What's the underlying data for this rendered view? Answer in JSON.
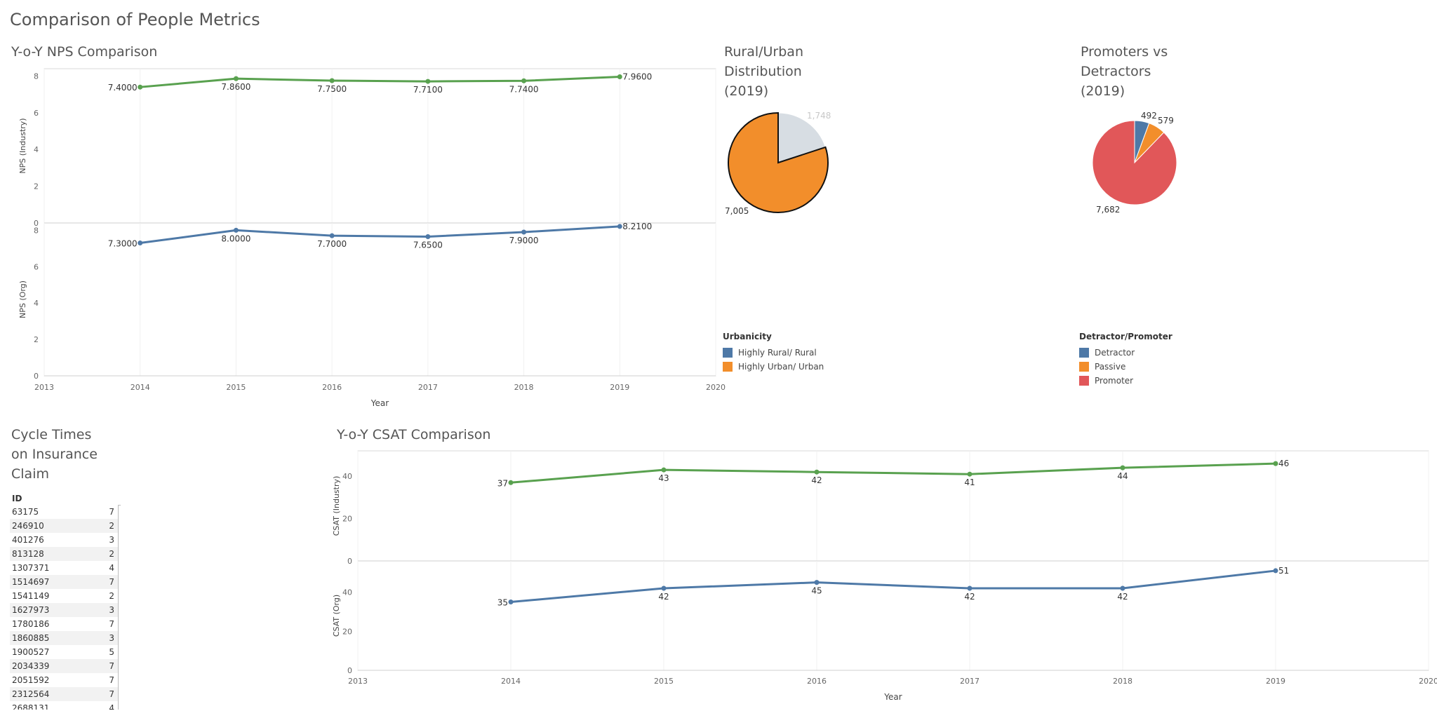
{
  "dashboard": {
    "title": "Comparison of People Metrics"
  },
  "nps": {
    "title": "Y-o-Y NPS Comparison",
    "xlabel": "Year"
  },
  "csat": {
    "title": "Y-o-Y CSAT Comparison",
    "xlabel": "Year"
  },
  "rural": {
    "title_lines": [
      "Rural/Urban",
      "Distribution",
      "(2019)"
    ],
    "legend_title": "Urbanicity",
    "legend": [
      "Highly Rural/ Rural",
      "Highly Urban/ Urban"
    ]
  },
  "promoters": {
    "title_lines": [
      "Promoters vs",
      "Detractors",
      "(2019)"
    ],
    "legend_title": "Detractor/Promoter",
    "legend": [
      "Detractor",
      "Passive",
      "Promoter"
    ]
  },
  "cycle": {
    "title_lines": [
      "Cycle Times",
      "on Insurance",
      "Claim"
    ],
    "column_header": "ID",
    "rows": [
      [
        "63175",
        "7"
      ],
      [
        "246910",
        "2"
      ],
      [
        "401276",
        "3"
      ],
      [
        "813128",
        "2"
      ],
      [
        "1307371",
        "4"
      ],
      [
        "1514697",
        "7"
      ],
      [
        "1541149",
        "2"
      ],
      [
        "1627973",
        "3"
      ],
      [
        "1780186",
        "7"
      ],
      [
        "1860885",
        "3"
      ],
      [
        "1900527",
        "5"
      ],
      [
        "2034339",
        "7"
      ],
      [
        "2051592",
        "7"
      ],
      [
        "2312564",
        "7"
      ],
      [
        "2688131",
        "4"
      ]
    ]
  },
  "colors": {
    "green": "#59a14f",
    "blue": "#4e79a7",
    "orange": "#f28e2b",
    "red": "#e15759",
    "light_gray": "#d7dde3"
  },
  "chart_data": [
    {
      "type": "line",
      "title": "Y-o-Y NPS Comparison",
      "xlabel": "Year",
      "x": [
        2014,
        2015,
        2016,
        2017,
        2018,
        2019
      ],
      "xlim": [
        2013,
        2020
      ],
      "x_ticks": [
        "2013",
        "2014",
        "2015",
        "2016",
        "2017",
        "2018",
        "2019",
        "2020"
      ],
      "series": [
        {
          "name": "NPS (Industry)",
          "values": [
            7.4,
            7.86,
            7.75,
            7.71,
            7.74,
            7.96
          ],
          "labels": [
            "7.4000",
            "7.8600",
            "7.7500",
            "7.7100",
            "7.7400",
            "7.9600"
          ],
          "ylim": [
            0,
            8.4
          ],
          "y_ticks": [
            "0",
            "2",
            "4",
            "6",
            "8"
          ]
        },
        {
          "name": "NPS (Org)",
          "values": [
            7.3,
            8.0,
            7.7,
            7.65,
            7.9,
            8.21
          ],
          "labels": [
            "7.3000",
            "8.0000",
            "7.7000",
            "7.6500",
            "7.9000",
            "8.2100"
          ],
          "ylim": [
            0,
            8.4
          ],
          "y_ticks": [
            "0",
            "2",
            "4",
            "6",
            "8"
          ]
        }
      ],
      "grid": true
    },
    {
      "type": "line",
      "title": "Y-o-Y CSAT Comparison",
      "xlabel": "Year",
      "x": [
        2014,
        2015,
        2016,
        2017,
        2018,
        2019
      ],
      "xlim": [
        2013,
        2020
      ],
      "x_ticks": [
        "2013",
        "2014",
        "2015",
        "2016",
        "2017",
        "2018",
        "2019",
        "2020"
      ],
      "series": [
        {
          "name": "CSAT (Industry)",
          "values": [
            37,
            43,
            42,
            41,
            44,
            46
          ],
          "labels": [
            "37",
            "43",
            "42",
            "41",
            "44",
            "46"
          ],
          "ylim": [
            0,
            52
          ],
          "y_ticks": [
            "0",
            "20",
            "40"
          ]
        },
        {
          "name": "CSAT (Org)",
          "values": [
            35,
            42,
            45,
            42,
            42,
            51
          ],
          "labels": [
            "35",
            "42",
            "45",
            "42",
            "42",
            "51"
          ],
          "ylim": [
            0,
            56
          ],
          "y_ticks": [
            "0",
            "20",
            "40"
          ]
        }
      ],
      "grid": true
    },
    {
      "type": "pie",
      "title": "Rural/Urban Distribution (2019)",
      "categories": [
        "Highly Rural/ Rural",
        "Highly Urban/ Urban"
      ],
      "values": [
        1748,
        7005
      ],
      "labels": [
        "1,748",
        "7,005"
      ]
    },
    {
      "type": "pie",
      "title": "Promoters vs Detractors (2019)",
      "categories": [
        "Detractor",
        "Passive",
        "Promoter"
      ],
      "values": [
        492,
        579,
        7682
      ],
      "labels": [
        "492",
        "579",
        "7,682"
      ]
    }
  ]
}
